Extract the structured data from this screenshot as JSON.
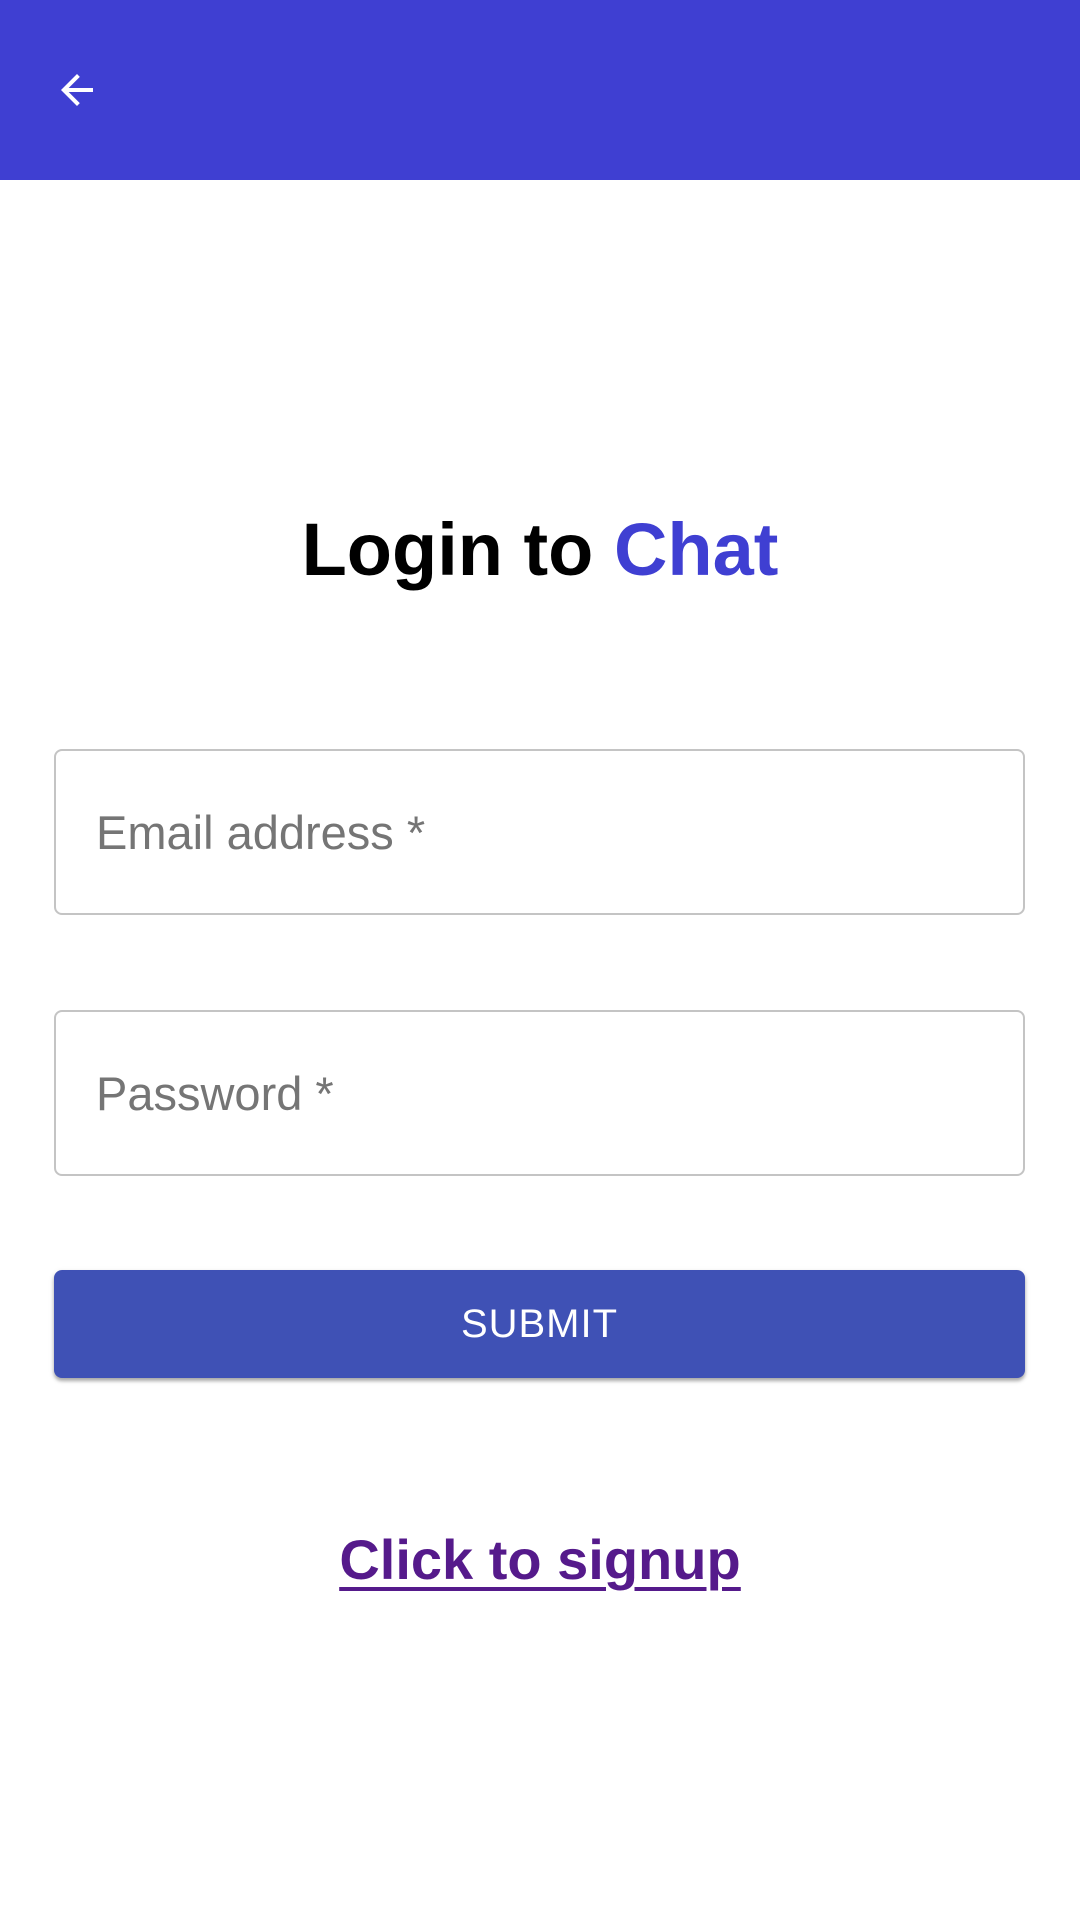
{
  "app_bar": {
    "back_icon": "arrow-left-icon",
    "color": "#3f3fd2"
  },
  "title": {
    "prefix": "Login to ",
    "accent": "Chat",
    "accent_color": "#3f3fd2"
  },
  "form": {
    "email_placeholder": "Email address *",
    "password_placeholder": "Password *",
    "submit_label": "SUBMIT",
    "submit_color": "#3f51b5"
  },
  "signup": {
    "label": "Click to signup",
    "color": "#551a8b"
  }
}
